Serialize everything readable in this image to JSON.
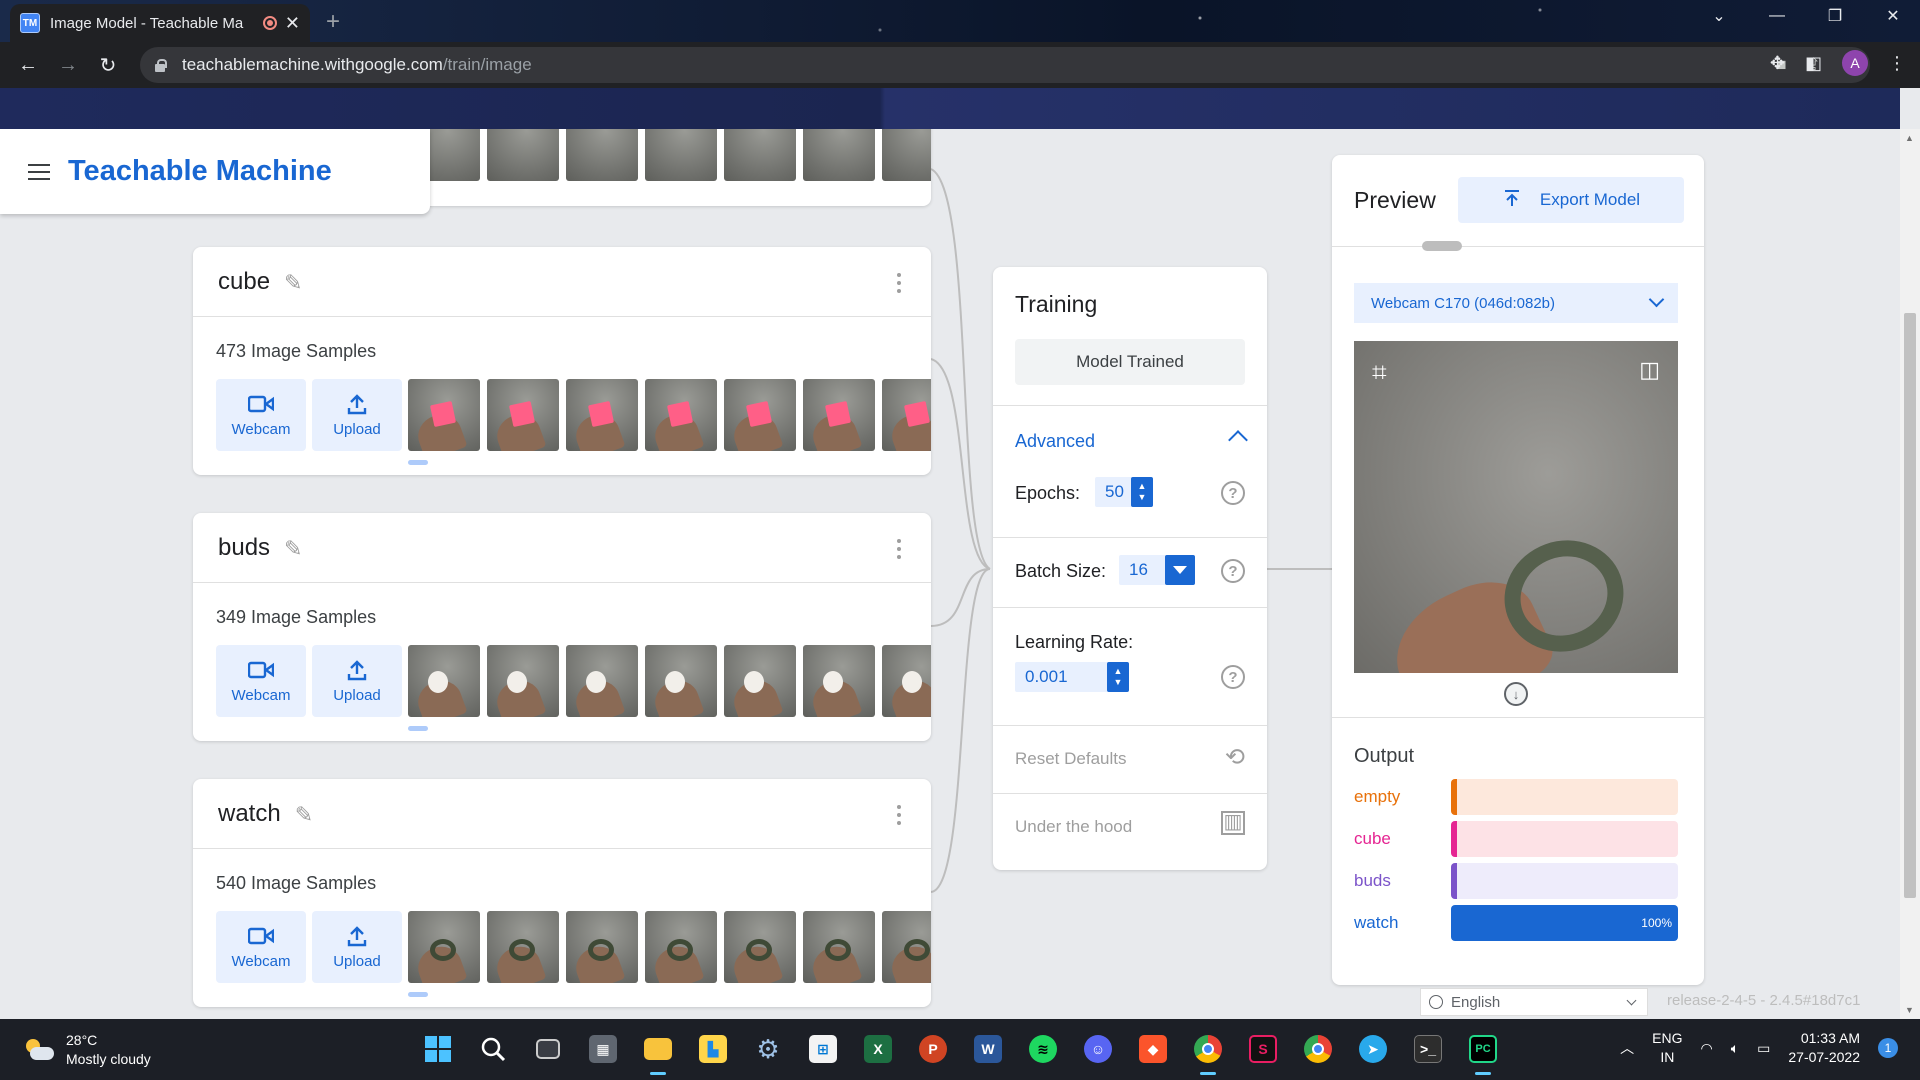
{
  "browser": {
    "tab_title": "Image Model - Teachable Ma",
    "favicon_text": "TM",
    "url_host": "teachablemachine.withgoogle.com",
    "url_path": "/train/image",
    "profile_initial": "A"
  },
  "app": {
    "logo": "Teachable Machine"
  },
  "classes": [
    {
      "name": "cube",
      "samples": "473 Image Samples",
      "webcam_label": "Webcam",
      "upload_label": "Upload"
    },
    {
      "name": "buds",
      "samples": "349 Image Samples",
      "webcam_label": "Webcam",
      "upload_label": "Upload"
    },
    {
      "name": "watch",
      "samples": "540 Image Samples",
      "webcam_label": "Webcam",
      "upload_label": "Upload"
    }
  ],
  "training": {
    "title": "Training",
    "status_button": "Model Trained",
    "advanced_label": "Advanced",
    "epochs_label": "Epochs:",
    "epochs_value": "50",
    "batch_label": "Batch Size:",
    "batch_value": "16",
    "lr_label": "Learning Rate:",
    "lr_value": "0.001",
    "reset_label": "Reset Defaults",
    "hood_label": "Under the hood"
  },
  "preview": {
    "title": "Preview",
    "export_label": "Export Model",
    "webcam_device": "Webcam C170 (046d:082b)",
    "output_title": "Output",
    "outputs": [
      {
        "label": "empty",
        "percent": 0,
        "text": "",
        "color": "#e8710a",
        "track": "#fde8dc",
        "fill": "#e8710a"
      },
      {
        "label": "cube",
        "percent": 0,
        "text": "",
        "color": "#e52592",
        "track": "#fde2e6",
        "fill": "#e52592"
      },
      {
        "label": "buds",
        "percent": 0,
        "text": "",
        "color": "#7b53c9",
        "track": "#eeecfb",
        "fill": "#7b53c9"
      },
      {
        "label": "watch",
        "percent": 100,
        "text": "100%",
        "color": "#1967d2",
        "track": "#dbe7fb",
        "fill": "#1967d2"
      }
    ]
  },
  "footer": {
    "language": "English",
    "release": "release-2-4-5 - 2.4.5#18d7c1"
  },
  "taskbar": {
    "temperature": "28°C",
    "weather": "Mostly cloudy",
    "lang_top": "ENG",
    "lang_bottom": "IN",
    "time": "01:33 AM",
    "date": "27-07-2022",
    "notifications": "1"
  }
}
